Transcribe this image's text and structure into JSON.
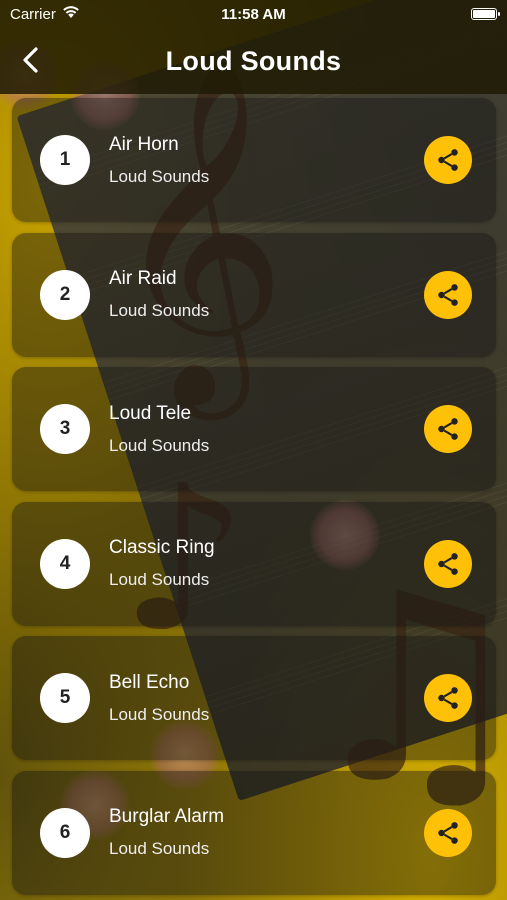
{
  "status_bar": {
    "carrier": "Carrier",
    "time": "11:58 AM"
  },
  "nav": {
    "title": "Loud Sounds",
    "back_icon": "chevron-left-icon"
  },
  "sounds": [
    {
      "number": "1",
      "title": "Air Horn",
      "subtitle": "Loud Sounds"
    },
    {
      "number": "2",
      "title": "Air Raid",
      "subtitle": "Loud Sounds"
    },
    {
      "number": "3",
      "title": "Loud Tele",
      "subtitle": "Loud Sounds"
    },
    {
      "number": "4",
      "title": "Classic Ring",
      "subtitle": "Loud Sounds"
    },
    {
      "number": "5",
      "title": "Bell Echo",
      "subtitle": "Loud Sounds"
    },
    {
      "number": "6",
      "title": "Burglar Alarm",
      "subtitle": "Loud Sounds"
    }
  ],
  "colors": {
    "accent": "#ffc107",
    "number_badge": "#ffffff"
  }
}
